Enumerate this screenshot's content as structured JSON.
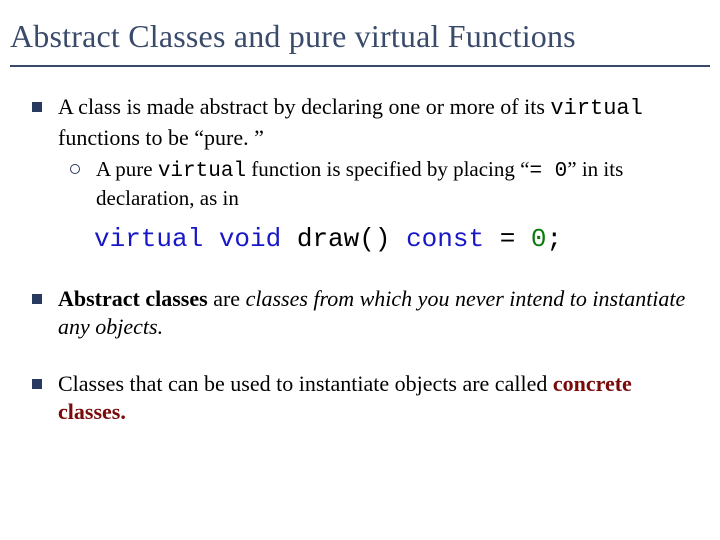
{
  "title": "Abstract Classes and pure virtual Functions",
  "bullets": {
    "b1": {
      "t1": "A class is made abstract by declaring one or more of its ",
      "code1": "virtual",
      "t2": " functions to be “pure. ”",
      "sub": {
        "t1": "A pure ",
        "code1": "virtual",
        "t2": " function is specified by placing “",
        "code2": "= 0",
        "t3": "” in its declaration, as in"
      },
      "codeline": {
        "kw1": "virtual",
        "kw2": "void",
        "fn": " draw() ",
        "kw3": "const",
        "eq": " = ",
        "num": "0",
        "semi": ";"
      }
    },
    "b2": {
      "bold1": "Abstract classes",
      "t1": " are ",
      "ital": "classes from which you never intend to instantiate any objects."
    },
    "b3": {
      "t1": "Classes that can be used to instantiate objects are called ",
      "bold1": "concrete classes."
    }
  }
}
